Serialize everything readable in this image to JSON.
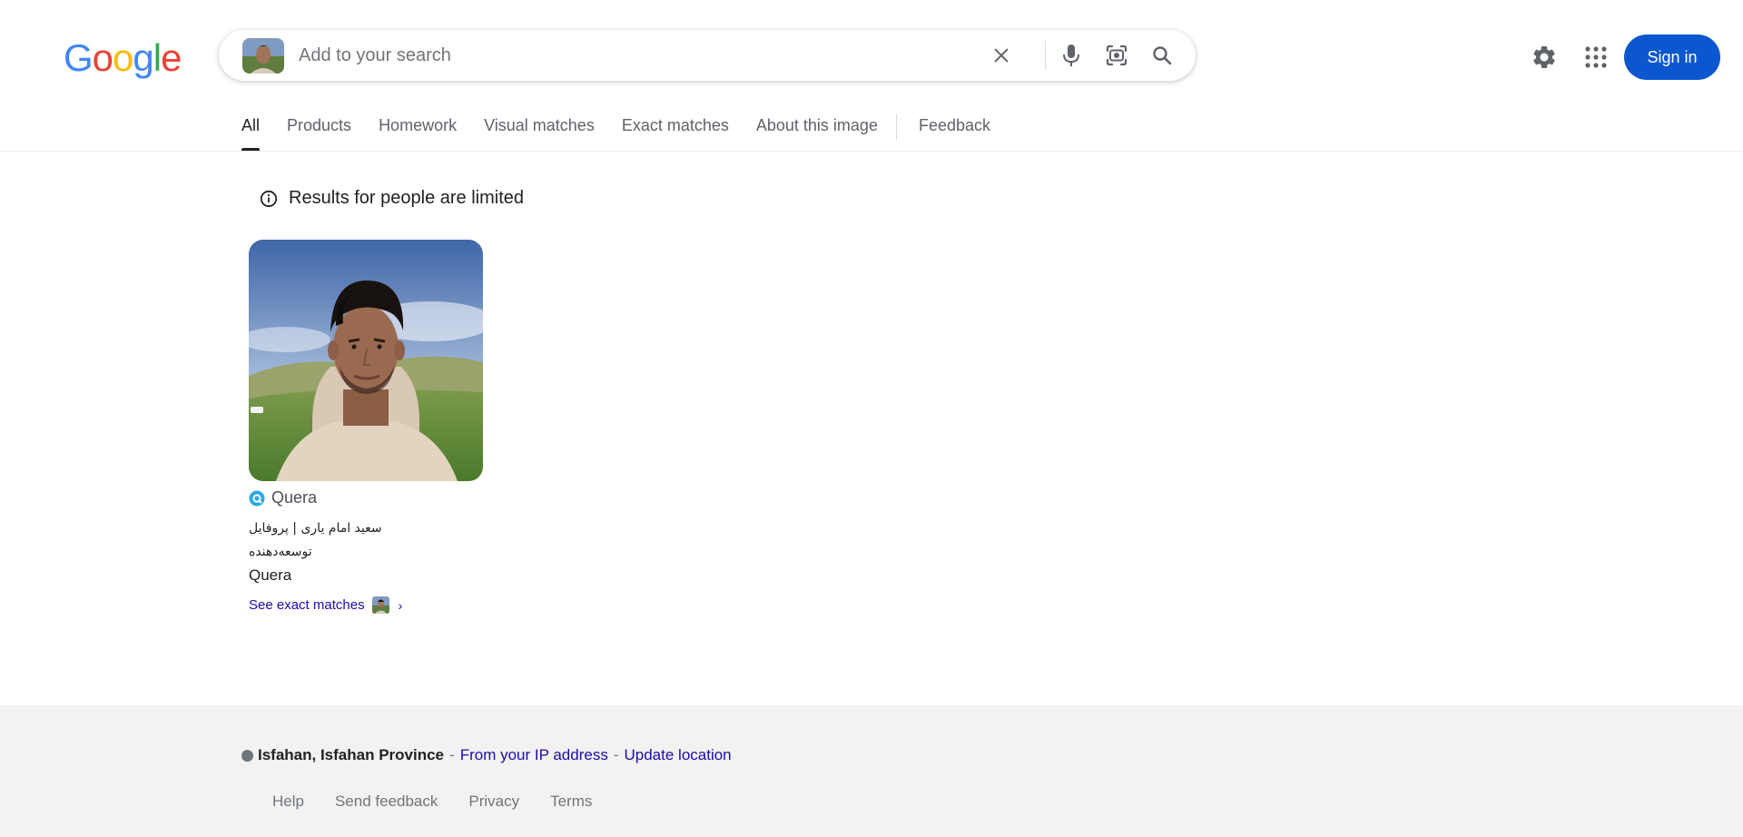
{
  "header": {
    "logo_letters": [
      "G",
      "o",
      "o",
      "g",
      "l",
      "e"
    ],
    "logo_colors": [
      "#4285f4",
      "#ea4335",
      "#fbbc05",
      "#4285f4",
      "#34a853",
      "#ea4335"
    ],
    "search": {
      "placeholder": "Add to your search",
      "value": ""
    },
    "icons": [
      "clear-icon",
      "microphone-icon",
      "lens-icon",
      "search-icon"
    ],
    "signin_label": "Sign in",
    "accent_color": "#0b57d0"
  },
  "tabs": [
    {
      "label": "All",
      "active": true
    },
    {
      "label": "Products",
      "active": false
    },
    {
      "label": "Homework",
      "active": false
    },
    {
      "label": "Visual matches",
      "active": false
    },
    {
      "label": "Exact matches",
      "active": false
    },
    {
      "label": "About this image",
      "active": false
    }
  ],
  "feedback_tab": "Feedback",
  "notice": {
    "text": "Results for people are limited"
  },
  "result": {
    "source": "Quera",
    "title_fa": "سعید امام یاری | پروفایل توسعه‌دهنده",
    "title_en": "Quera",
    "exact_matches_label": "See exact matches"
  },
  "footer": {
    "location_place": "Isfahan, Isfahan Province",
    "location_source": "From your IP address",
    "update_location": "Update location",
    "links": [
      "Help",
      "Send feedback",
      "Privacy",
      "Terms"
    ]
  }
}
